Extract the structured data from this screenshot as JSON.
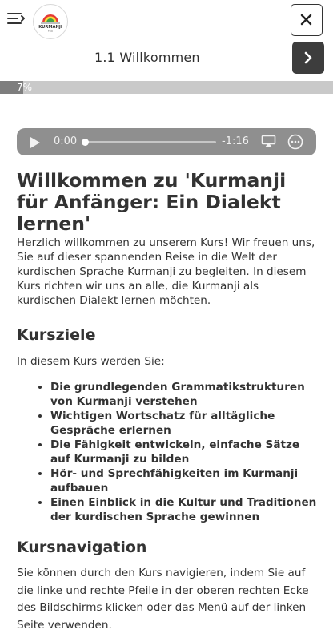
{
  "header": {
    "menu_icon": "menu-collapse-icon",
    "logo_text": "KURMANJI",
    "logo_subtext": "FOR",
    "close_icon": "close-icon",
    "lesson_title": "1.1 Willkommen",
    "next_icon": "chevron-right-icon"
  },
  "progress": {
    "label": "7%",
    "value": 0.07
  },
  "audio": {
    "current_time": "0:00",
    "remaining_time": "-1:16",
    "play_icon": "play-icon",
    "airplay_icon": "airplay-icon",
    "more_icon": "more-options-icon"
  },
  "article": {
    "title": "Willkommen zu 'Kurmanji für Anfänger: Ein Dialekt lernen'",
    "intro": "Herzlich willkommen zu unserem Kurs! Wir freuen uns, Sie auf dieser spannenden Reise in die Welt der kurdischen Sprache Kurmanji zu begleiten. In diesem Kurs richten wir uns an alle, die Kurmanji als kurdischen Dialekt lernen möchten.",
    "goals_heading": "Kursziele",
    "goals_lead": "In diesem Kurs werden Sie:",
    "goals": [
      "Die grundlegenden Grammatikstrukturen von Kurmanji verstehen",
      "Wichtigen Wortschatz für alltägliche Gespräche erlernen",
      "Die Fähigkeit entwickeln, einfache Sätze auf Kurmanji zu bilden",
      "Hör- und Sprechfähigkeiten im Kurmanji aufbauen",
      "Einen Einblick in die Kultur und Traditionen der kurdischen Sprache gewinnen"
    ],
    "nav_heading": "Kursnavigation",
    "nav_text": "Sie können durch den Kurs navigieren, indem Sie auf die linke und rechte Pfeile in der oberen rechten Ecke des Bildschirms klicken oder das Menü auf der linken Seite verwenden."
  },
  "colors": {
    "player_bg": "#8f8f8f",
    "progress_track": "#c9c9c9",
    "progress_fill": "#7e7e7e",
    "next_button": "#3d3d3d"
  }
}
